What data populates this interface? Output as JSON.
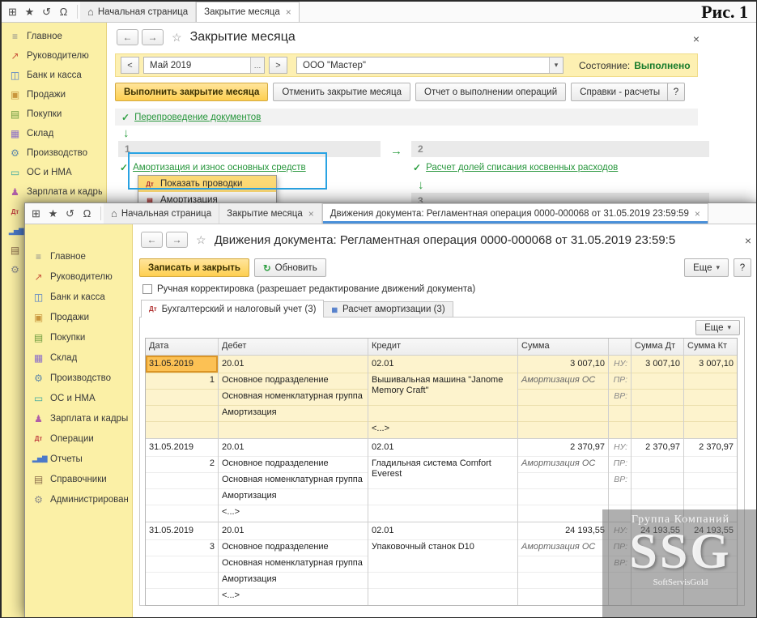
{
  "figure_label": "Рис. 1",
  "glyphs": {
    "back": "←",
    "forward": "→",
    "star": "☆",
    "close": "×",
    "dropdown": "▾",
    "ellipsis": "…",
    "refresh": "↻",
    "check": "✓",
    "down_arrow": "↓",
    "right_arrow": "→",
    "home": "⌂"
  },
  "topbar_icons": [
    {
      "id": "apps-menu",
      "glyph": "⊞"
    },
    {
      "id": "favorites",
      "glyph": "★"
    },
    {
      "id": "history",
      "glyph": "↺"
    },
    {
      "id": "notifications",
      "glyph": "Ω"
    }
  ],
  "sidebar_items": [
    {
      "id": "glavnoe",
      "label": "Главное",
      "glyph": "≡",
      "color": "#8a8a8a"
    },
    {
      "id": "rukovoditelyu",
      "label": "Руководителю",
      "glyph": "↗",
      "color": "#c9563c"
    },
    {
      "id": "bank-i-kassa",
      "label": "Банк и касса",
      "glyph": "◫",
      "color": "#4b79c9"
    },
    {
      "id": "prodazhi",
      "label": "Продажи",
      "glyph": "▣",
      "color": "#c9963c"
    },
    {
      "id": "pokupki",
      "label": "Покупки",
      "glyph": "▤",
      "color": "#6c9a3c"
    },
    {
      "id": "sklad",
      "label": "Склад",
      "glyph": "▦",
      "color": "#8a6cc9"
    },
    {
      "id": "proizvodstvo",
      "label": "Производство",
      "glyph": "⚙",
      "color": "#5f87a8"
    },
    {
      "id": "os-i-nma",
      "label": "ОС и НМА",
      "glyph": "▭",
      "color": "#3ca8a0"
    },
    {
      "id": "zarplata-i-kadry",
      "label": "Зарплата и кадры",
      "glyph": "♟",
      "color": "#b05fa8"
    },
    {
      "id": "operatsii",
      "label": "Операции",
      "glyph": "Дт",
      "color": "#c04040",
      "text_icon": true
    },
    {
      "id": "otchety",
      "label": "Отчеты",
      "glyph": "▂▅▇",
      "color": "#4b79c9",
      "text_icon": true
    },
    {
      "id": "spravochniki",
      "label": "Справочники",
      "glyph": "▤",
      "color": "#8a6c4b"
    },
    {
      "id": "administrirovanie",
      "label": "Администрирование",
      "glyph": "⚙",
      "color": "#8a8a8a"
    }
  ],
  "bg_window": {
    "tabs": [
      {
        "id": "home",
        "label": "Начальная страница",
        "home": true
      },
      {
        "id": "month-closing",
        "label": "Закрытие месяца",
        "active": true,
        "closable": true
      }
    ],
    "title": "Закрытие месяца",
    "toolbar": {
      "prev": "<",
      "next": ">",
      "period": "Май 2019",
      "org": "ООО \"Мастер\"",
      "status_label": "Состояние:",
      "status_value": "Выполнено"
    },
    "buttons": {
      "run": "Выполнить закрытие месяца",
      "cancel": "Отменить закрытие месяца",
      "report": "Отчет о выполнении операций",
      "refs": "Справки - расчеты",
      "help": "?"
    },
    "reposting_link": "Перепроведение документов",
    "sections": {
      "s1_num": "1",
      "s1_link": "Амортизация и износ основных средств",
      "menu": [
        {
          "label": "Показать проводки",
          "glyph": "Дт",
          "highlight": true
        },
        {
          "label": "Амортизация",
          "glyph": "▤"
        }
      ],
      "s2_num": "2",
      "s2_link": "Расчет долей списания косвенных расходов",
      "s3_num": "3"
    }
  },
  "fg_window": {
    "tabs": [
      {
        "id": "home",
        "label": "Начальная страница",
        "home": true
      },
      {
        "id": "month-closing",
        "label": "Закрытие месяца",
        "closable": true
      },
      {
        "id": "doc-movements",
        "label": "Движения документа: Регламентная операция 0000-000068 от 31.05.2019 23:59:59",
        "active": true,
        "closable": true
      }
    ],
    "title": "Движения документа: Регламентная операция 0000-000068 от 31.05.2019 23:59:5",
    "commands": {
      "save": "Записать и закрыть",
      "refresh": "Обновить",
      "more": "Еще",
      "help": "?"
    },
    "manual_adjust_label": "Ручная корректировка (разрешает редактирование движений документа)",
    "doc_tabs": [
      {
        "label": "Бухгалтерский и налоговый учет (3)",
        "glyph": "Дт",
        "active": true
      },
      {
        "label": "Расчет амортизации (3)",
        "glyph": "▦"
      }
    ],
    "panel_more": "Еще",
    "table": {
      "headers": [
        "Дата",
        "Дебет",
        "Кредит",
        "Сумма",
        "",
        "Сумма Дт",
        "Сумма Кт"
      ],
      "side_labels": [
        "НУ:",
        "ПР:",
        "ВР:"
      ],
      "blocks": [
        {
          "selected": true,
          "date": "31.05.2019",
          "num": "1",
          "debit_account": "20.01",
          "credit_account": "02.01",
          "amount": "3 007,10",
          "note": "Амортизация ОС",
          "sum_dt": "3 007,10",
          "sum_kt": "3 007,10",
          "debit_subs": [
            "Основное подразделение",
            "Основная номенклатурная группа",
            "Амортизация",
            ""
          ],
          "credit_main": "Вышивальная машина \"Janome Memory Craft\"",
          "credit_tail": "<...>"
        },
        {
          "selected": false,
          "date": "31.05.2019",
          "num": "2",
          "debit_account": "20.01",
          "credit_account": "02.01",
          "amount": "2 370,97",
          "note": "Амортизация ОС",
          "sum_dt": "2 370,97",
          "sum_kt": "2 370,97",
          "debit_subs": [
            "Основное подразделение",
            "Основная номенклатурная группа",
            "Амортизация",
            "<...>"
          ],
          "credit_main": "Гладильная система Comfort Everest",
          "credit_tail": ""
        },
        {
          "selected": false,
          "date": "31.05.2019",
          "num": "3",
          "debit_account": "20.01",
          "credit_account": "02.01",
          "amount": "24 193,55",
          "note": "Амортизация ОС",
          "sum_dt": "24 193,55",
          "sum_kt": "24 193,55",
          "debit_subs": [
            "Основное подразделение",
            "Основная номенклатурная группа",
            "Амортизация",
            "<...>"
          ],
          "credit_main": "Упаковочный станок D10",
          "credit_tail": ""
        }
      ]
    }
  },
  "watermark": {
    "line1": "Группа Компаний",
    "big": "SSG",
    "line2": "SoftServisGold"
  }
}
